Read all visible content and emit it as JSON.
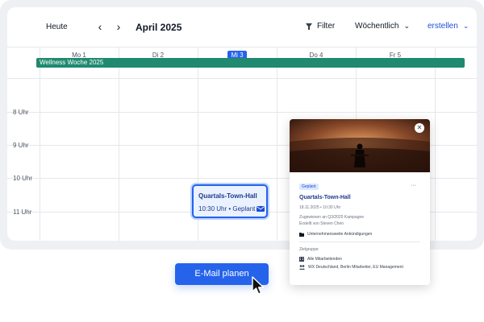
{
  "toolbar": {
    "today_label": "Heute",
    "prev_icon": "chevron-left-icon",
    "next_icon": "chevron-right-icon",
    "month_label": "April 2025",
    "filter_label": "Filter",
    "view_label": "Wöchentlich",
    "create_label": "erstellen"
  },
  "days": [
    {
      "label": "Mo 1"
    },
    {
      "label": "Di 2"
    },
    {
      "label": "Mi 3",
      "today": true
    },
    {
      "label": "Do 4"
    },
    {
      "label": "Fr 5"
    }
  ],
  "hours": [
    "8 Uhr",
    "9 Uhr",
    "10 Uhr",
    "11 Uhr"
  ],
  "banner": {
    "label": "Wellness Woche 2025",
    "color": "#1f8a6f"
  },
  "event": {
    "title": "Quartals-Town-Hall",
    "time_status": "10:30 Uhr • Geplant",
    "icon": "mail-icon"
  },
  "popup": {
    "badge": "Geplant",
    "more": "···",
    "title": "Quartals-Town-Hall",
    "datetime": "18.11.2025 • 10:30 Uhr",
    "assigned": "Zugewiesen an Q3/2025 Kampagne",
    "created": "Erstellt von Steven Chen",
    "folder": "Unternehmensweite Ankündigungen",
    "target_label": "Zielgruppe",
    "all_employees": "Alle Mitarbeitenden",
    "groups": "WX Deutschland, Berlin Mitarbeiter, EU Management"
  },
  "cta": {
    "label": "E-Mail planen"
  },
  "colors": {
    "accent": "#2563eb",
    "banner": "#1f8a6f"
  }
}
